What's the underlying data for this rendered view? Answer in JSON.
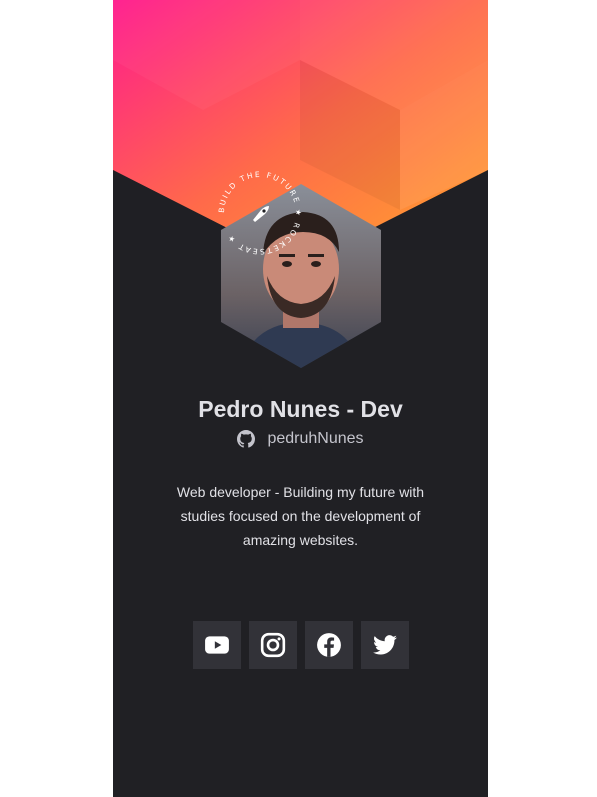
{
  "profile": {
    "name": "Pedro Nunes - Dev",
    "username": "pedruhNunes",
    "bio": "Web developer - Building my future with studies focused on the development of amazing websites."
  },
  "badge": {
    "text": "BUILD THE FUTURE ★ ROCKETSEAT ★"
  },
  "socials": [
    {
      "name": "youtube",
      "icon": "youtube-icon"
    },
    {
      "name": "instagram",
      "icon": "instagram-icon"
    },
    {
      "name": "facebook",
      "icon": "facebook-icon"
    },
    {
      "name": "twitter",
      "icon": "twitter-icon"
    }
  ],
  "colors": {
    "background": "#202024",
    "button": "#323238",
    "gradient_start": "#ff1b8d",
    "gradient_end": "#ffa62b",
    "accent_star": "#f7b733"
  }
}
